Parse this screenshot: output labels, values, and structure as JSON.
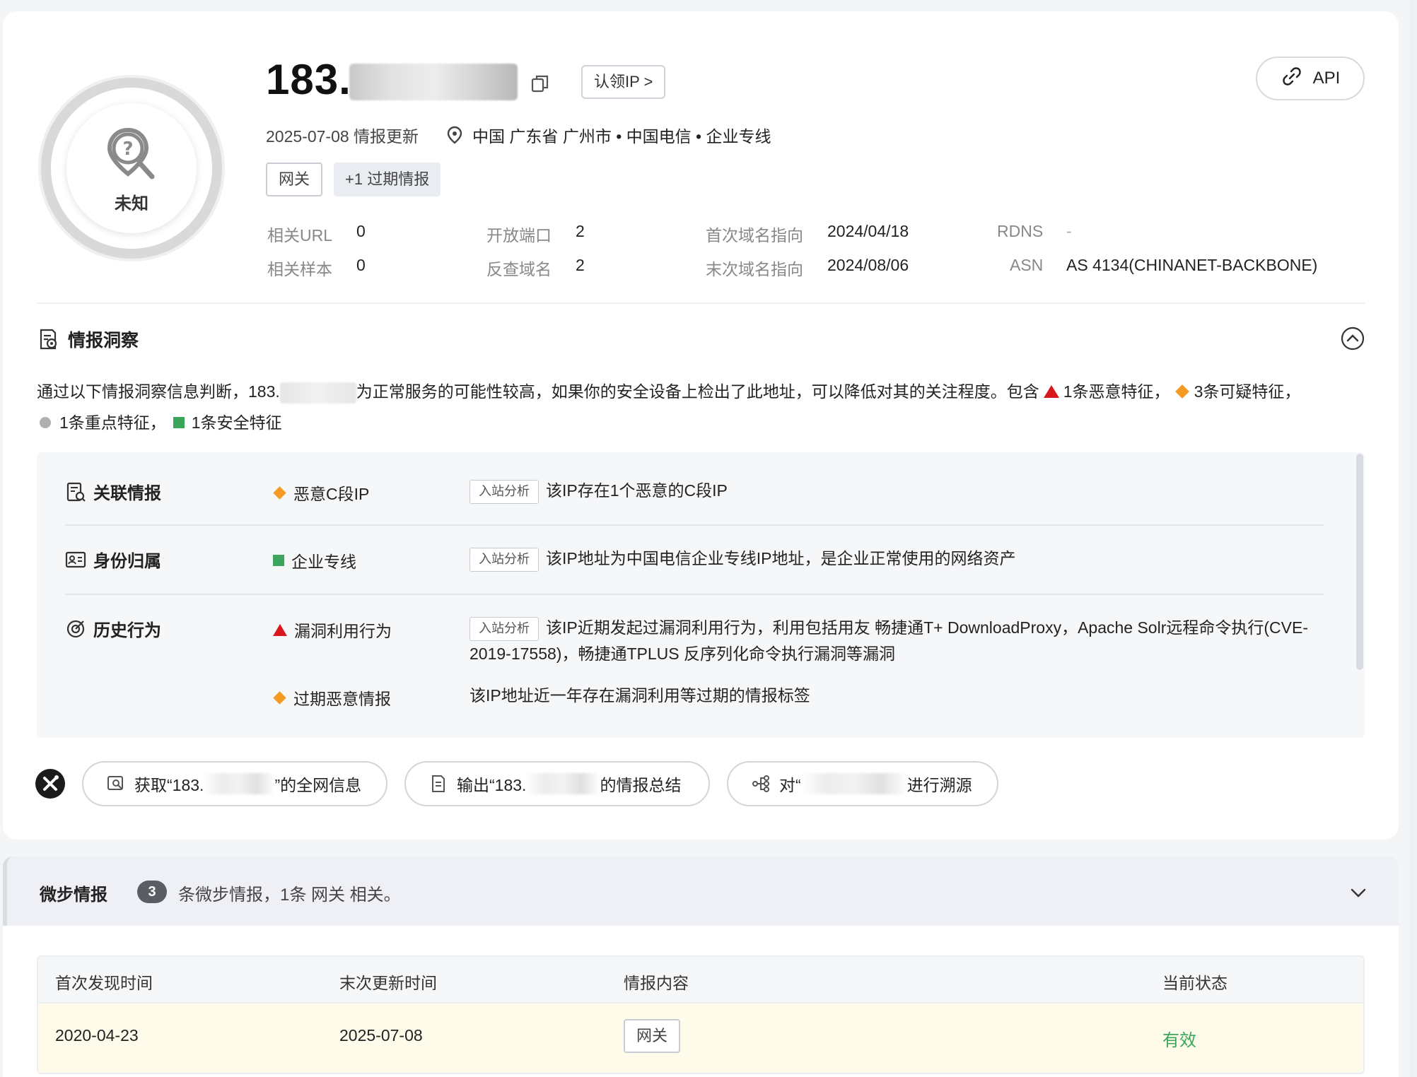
{
  "header": {
    "ip_prefix": "183.",
    "claim_label": "认领IP >",
    "api_label": "API",
    "risk_label": "未知",
    "update_date": "2025-07-08 情报更新",
    "location": "中国 广东省 广州市 • 中国电信 • 企业专线",
    "tags": [
      "网关",
      "+1 过期情报"
    ],
    "stats": [
      {
        "label": "相关URL",
        "value": "0"
      },
      {
        "label": "相关样本",
        "value": "0"
      },
      {
        "label": "开放端口",
        "value": "2"
      },
      {
        "label": "反查域名",
        "value": "2"
      },
      {
        "label": "首次域名指向",
        "value": "2024/04/18"
      },
      {
        "label": "末次域名指向",
        "value": "2024/08/06"
      },
      {
        "label": "RDNS",
        "value": "-"
      },
      {
        "label": "ASN",
        "value": "AS 4134(CHINANET-BACKBONE)"
      }
    ]
  },
  "insight": {
    "title": "情报洞察",
    "summary_part1": "通过以下情报洞察信息判断，183.",
    "summary_part2": "为正常服务的可能性较高，如果你的安全设备上检出了此地址，可以降低对其的关注程度。包含",
    "malicious": "1条恶意特征，",
    "suspicious": "3条可疑特征，",
    "key": "1条重点特征，",
    "safe": "1条安全特征",
    "rows": [
      {
        "category": "关联情报",
        "feature": "恶意C段IP",
        "button": "入站分析",
        "desc": "该IP存在1个恶意的C段IP"
      },
      {
        "category": "身份归属",
        "feature": "企业专线",
        "button": "入站分析",
        "desc": "该IP地址为中国电信企业专线IP地址，是企业正常使用的网络资产"
      },
      {
        "category": "历史行为",
        "feature": "漏洞利用行为",
        "button": "入站分析",
        "desc": "该IP近期发起过漏洞利用行为，利用包括用友 畅捷通T+ DownloadProxy，Apache Solr远程命令执行(CVE-2019-17558)，畅捷通TPLUS 反序列化命令执行漏洞等漏洞"
      },
      {
        "category": "",
        "feature": "过期恶意情报",
        "button": "",
        "desc": "该IP地址近一年存在漏洞利用等过期的情报标签"
      }
    ]
  },
  "actions": [
    {
      "prefix": "获取“183.",
      "suffix": "”的全网信息"
    },
    {
      "prefix": "输出“183.",
      "suffix": "的情报总结"
    },
    {
      "prefix": "对“",
      "suffix": "进行溯源"
    }
  ],
  "step_intel": {
    "title": "微步情报",
    "count": "3",
    "text": "条微步情报，1条 网关 相关。",
    "columns": [
      "首次发现时间",
      "末次更新时间",
      "情报内容",
      "当前状态"
    ],
    "rows": [
      {
        "first_seen": "2020-04-23",
        "last_update": "2025-07-08",
        "content": "网关",
        "status": "有效"
      }
    ]
  },
  "colors": {
    "malicious": "#d9181e",
    "suspicious": "#f59a23",
    "key": "#b0b0b0",
    "safe": "#3ba55c"
  }
}
